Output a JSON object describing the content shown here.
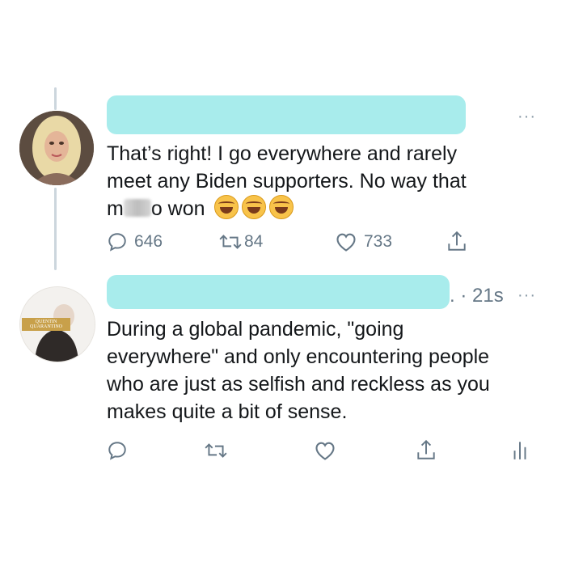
{
  "tweets": [
    {
      "text_line1": "That’s right! I go everywhere and rarely",
      "text_line2": "meet any Biden supporters. No way that",
      "text_line3_a": "m",
      "text_line3_b": "o won",
      "more": "···",
      "reply_count": "646",
      "retweet_count": "84",
      "like_count": "733"
    },
    {
      "timestamp": ". · 21s",
      "more": "···",
      "text_line1": "During a global pandemic, \"going",
      "text_line2": "everywhere\" and only encountering people",
      "text_line3": "who are just as selfish and reckless as you",
      "text_line4": "makes quite a bit of sense.",
      "avatar_badge": "QUENTIN QUARANTINO"
    }
  ],
  "colors": {
    "redaction": "#a8ecec",
    "icon_gray": "#657786",
    "thread_line": "#ccd6dd"
  },
  "icons": [
    "reply-icon",
    "retweet-icon",
    "like-icon",
    "share-icon",
    "analytics-icon",
    "more-icon"
  ]
}
